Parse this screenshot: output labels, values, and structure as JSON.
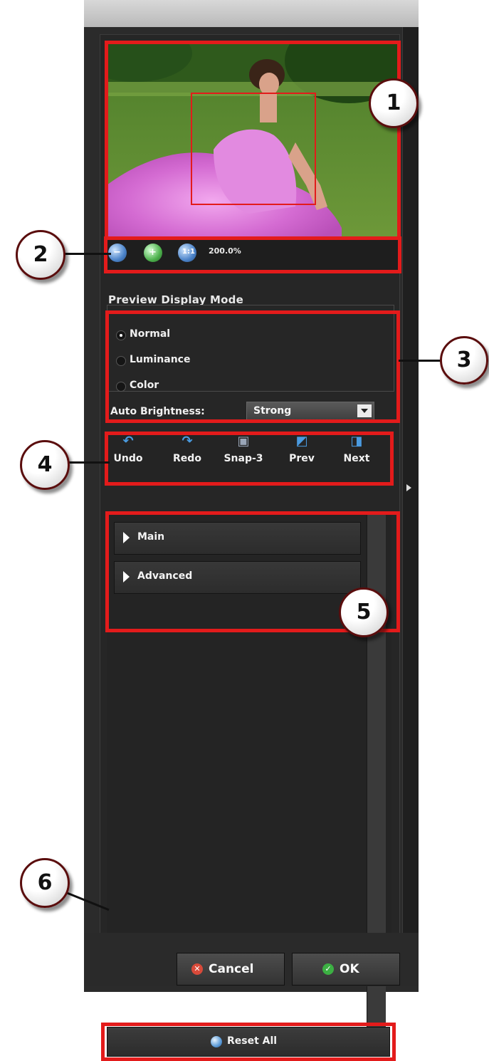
{
  "zoom": {
    "value": "200.0%",
    "buttons": [
      {
        "name": "zoom-out",
        "icon": "zoom-out-icon"
      },
      {
        "name": "zoom-in",
        "icon": "zoom-in-icon"
      },
      {
        "name": "zoom-fit",
        "icon": "zoom-fit-icon"
      }
    ]
  },
  "preview_mode": {
    "title": "Preview Display Mode",
    "options": [
      "Normal",
      "Luminance",
      "Color"
    ],
    "selected": "Normal",
    "auto_brightness_label": "Auto Brightness:",
    "auto_brightness_value": "Strong"
  },
  "toolbar": {
    "undo": "Undo",
    "redo": "Redo",
    "snap": "Snap-3",
    "prev": "Prev",
    "next": "Next"
  },
  "sections": {
    "main": "Main",
    "advanced": "Advanced"
  },
  "reset_label": "Reset All",
  "dialog": {
    "cancel": "Cancel",
    "ok": "OK"
  },
  "callouts": [
    "1",
    "2",
    "3",
    "4",
    "5",
    "6"
  ],
  "colors": {
    "highlight": "#e31b1b",
    "panel": "#2b2b2b",
    "icon_blue": "#4a9be0"
  }
}
